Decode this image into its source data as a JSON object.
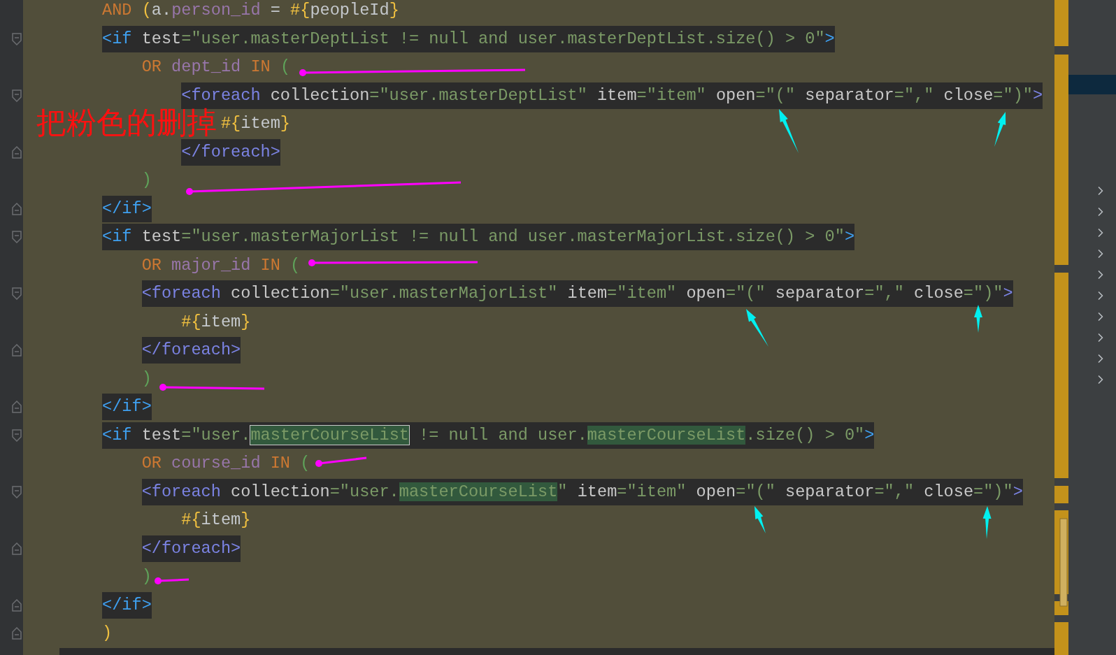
{
  "annotation": {
    "note": "把粉色的删掉"
  },
  "lines": [
    {
      "boxed": false,
      "fold_start": false,
      "fold_end": false,
      "tokens": [
        {
          "kind": "kw",
          "text": "AND"
        },
        {
          "kind": "brace",
          "text": " ("
        },
        {
          "kind": "plain",
          "text": "a."
        },
        {
          "kind": "col",
          "text": "person_id"
        },
        {
          "kind": "plain",
          "text": " = "
        },
        {
          "kind": "brace",
          "text": "#{"
        },
        {
          "kind": "plain",
          "text": "peopleId"
        },
        {
          "kind": "brace",
          "text": "}"
        }
      ]
    },
    {
      "boxed": true,
      "fold_start": true,
      "fold_end": false,
      "tokens": [
        {
          "kind": "tag",
          "text": "<if"
        },
        {
          "kind": "attr",
          "text": " test"
        },
        {
          "kind": "str",
          "text": "=\"user.masterDeptList != null and user.masterDeptList.size() > 0\""
        },
        {
          "kind": "tag",
          "text": ">"
        }
      ],
      "children": [
        {
          "boxed": false,
          "fold_start": false,
          "fold_end": false,
          "tokens": [
            {
              "kind": "kw",
              "text": "OR"
            },
            {
              "kind": "col",
              "text": " dept_id"
            },
            {
              "kind": "kw",
              "text": " IN"
            },
            {
              "kind": "paren",
              "text": " ("
            }
          ],
          "children": [
            {
              "boxed": true,
              "fold_start": true,
              "fold_end": false,
              "tokens": [
                {
                  "kind": "tag2",
                  "text": "<foreach"
                },
                {
                  "kind": "attr",
                  "text": " collection"
                },
                {
                  "kind": "str",
                  "text": "=\"user.masterDeptList\""
                },
                {
                  "kind": "attr",
                  "text": " item"
                },
                {
                  "kind": "str",
                  "text": "=\"item\""
                },
                {
                  "kind": "attr",
                  "text": " open"
                },
                {
                  "kind": "str",
                  "text": "=\"(\""
                },
                {
                  "kind": "attr",
                  "text": " separator"
                },
                {
                  "kind": "str",
                  "text": "=\",\""
                },
                {
                  "kind": "attr",
                  "text": " close"
                },
                {
                  "kind": "str",
                  "text": "=\")\""
                },
                {
                  "kind": "tag2",
                  "text": ">"
                }
              ],
              "children": [
                {
                  "boxed": false,
                  "fold_start": false,
                  "fold_end": false,
                  "tokens": [
                    {
                      "kind": "brace",
                      "text": "#{"
                    },
                    {
                      "kind": "plain",
                      "text": "item"
                    },
                    {
                      "kind": "brace",
                      "text": "}"
                    }
                  ]
                }
              ]
            },
            {
              "boxed": true,
              "fold_start": false,
              "fold_end": true,
              "tokens": [
                {
                  "kind": "tag2",
                  "text": "</foreach>"
                }
              ]
            }
          ]
        },
        {
          "boxed": false,
          "fold_start": false,
          "fold_end": false,
          "tokens": [
            {
              "kind": "paren",
              "text": ")"
            }
          ]
        }
      ]
    },
    {
      "boxed": true,
      "fold_start": false,
      "fold_end": true,
      "tokens": [
        {
          "kind": "tag",
          "text": "</if>"
        }
      ]
    },
    {
      "boxed": true,
      "fold_start": true,
      "fold_end": false,
      "tokens": [
        {
          "kind": "tag",
          "text": "<if"
        },
        {
          "kind": "attr",
          "text": " test"
        },
        {
          "kind": "str",
          "text": "=\"user.masterMajorList != null and user.masterMajorList.size() > 0\""
        },
        {
          "kind": "tag",
          "text": ">"
        }
      ],
      "children": [
        {
          "boxed": false,
          "fold_start": false,
          "fold_end": false,
          "tokens": [
            {
              "kind": "kw",
              "text": "OR"
            },
            {
              "kind": "col",
              "text": " major_id"
            },
            {
              "kind": "kw",
              "text": " IN"
            },
            {
              "kind": "paren",
              "text": " ("
            }
          ]
        },
        {
          "boxed": true,
          "fold_start": true,
          "fold_end": false,
          "tokens": [
            {
              "kind": "tag2",
              "text": "<foreach"
            },
            {
              "kind": "attr",
              "text": " collection"
            },
            {
              "kind": "str",
              "text": "=\"user.masterMajorList\""
            },
            {
              "kind": "attr",
              "text": " item"
            },
            {
              "kind": "str",
              "text": "=\"item\""
            },
            {
              "kind": "attr",
              "text": " open"
            },
            {
              "kind": "str",
              "text": "=\"(\""
            },
            {
              "kind": "attr",
              "text": " separator"
            },
            {
              "kind": "str",
              "text": "=\",\""
            },
            {
              "kind": "attr",
              "text": " close"
            },
            {
              "kind": "str",
              "text": "=\")\""
            },
            {
              "kind": "tag2",
              "text": ">"
            }
          ],
          "children": [
            {
              "boxed": false,
              "fold_start": false,
              "fold_end": false,
              "tokens": [
                {
                  "kind": "brace",
                  "text": "#{"
                },
                {
                  "kind": "plain",
                  "text": "item"
                },
                {
                  "kind": "brace",
                  "text": "}"
                }
              ]
            }
          ]
        },
        {
          "boxed": true,
          "fold_start": false,
          "fold_end": true,
          "tokens": [
            {
              "kind": "tag2",
              "text": "</foreach>"
            }
          ]
        },
        {
          "boxed": false,
          "fold_start": false,
          "fold_end": false,
          "tokens": [
            {
              "kind": "paren",
              "text": ")"
            }
          ]
        }
      ]
    },
    {
      "boxed": true,
      "fold_start": false,
      "fold_end": true,
      "tokens": [
        {
          "kind": "tag",
          "text": "</if>"
        }
      ]
    },
    {
      "boxed": true,
      "fold_start": true,
      "fold_end": false,
      "tokens": [
        {
          "kind": "tag",
          "text": "<if"
        },
        {
          "kind": "attr",
          "text": " test"
        },
        {
          "kind": "str",
          "text": "=\"user."
        },
        {
          "kind": "str",
          "text": "masterCourseList",
          "found": true,
          "selected": true
        },
        {
          "kind": "str",
          "text": " != null and user."
        },
        {
          "kind": "str",
          "text": "masterCourseList",
          "found": true,
          "selected": false
        },
        {
          "kind": "str",
          "text": ".size() > 0\""
        },
        {
          "kind": "tag",
          "text": ">"
        }
      ],
      "children": [
        {
          "boxed": false,
          "fold_start": false,
          "fold_end": false,
          "tokens": [
            {
              "kind": "kw",
              "text": "OR"
            },
            {
              "kind": "col",
              "text": " course_id"
            },
            {
              "kind": "kw",
              "text": " IN"
            },
            {
              "kind": "paren",
              "text": " ("
            }
          ]
        },
        {
          "boxed": true,
          "fold_start": true,
          "fold_end": false,
          "tokens": [
            {
              "kind": "tag2",
              "text": "<foreach"
            },
            {
              "kind": "attr",
              "text": " collection"
            },
            {
              "kind": "str",
              "text": "=\"user."
            },
            {
              "kind": "str",
              "text": "masterCourseList",
              "found": true,
              "selected": false
            },
            {
              "kind": "str",
              "text": "\""
            },
            {
              "kind": "attr",
              "text": " item"
            },
            {
              "kind": "str",
              "text": "=\"item\""
            },
            {
              "kind": "attr",
              "text": " open"
            },
            {
              "kind": "str",
              "text": "=\"(\""
            },
            {
              "kind": "attr",
              "text": " separator"
            },
            {
              "kind": "str",
              "text": "=\",\""
            },
            {
              "kind": "attr",
              "text": " close"
            },
            {
              "kind": "str",
              "text": "=\")\""
            },
            {
              "kind": "tag2",
              "text": ">"
            }
          ],
          "children": [
            {
              "boxed": false,
              "fold_start": false,
              "fold_end": false,
              "tokens": [
                {
                  "kind": "brace",
                  "text": "#{"
                },
                {
                  "kind": "plain",
                  "text": "item"
                },
                {
                  "kind": "brace",
                  "text": "}"
                }
              ]
            }
          ]
        },
        {
          "boxed": true,
          "fold_start": false,
          "fold_end": true,
          "tokens": [
            {
              "kind": "tag2",
              "text": "</foreach>"
            }
          ]
        },
        {
          "boxed": false,
          "fold_start": false,
          "fold_end": false,
          "tokens": [
            {
              "kind": "paren",
              "text": ")"
            }
          ]
        }
      ]
    },
    {
      "boxed": true,
      "fold_start": false,
      "fold_end": true,
      "tokens": [
        {
          "kind": "tag",
          "text": "</if>"
        }
      ]
    },
    {
      "boxed": false,
      "fold_start": false,
      "fold_end": true,
      "tokens": [
        {
          "kind": "brace",
          "text": ")"
        }
      ]
    }
  ]
}
